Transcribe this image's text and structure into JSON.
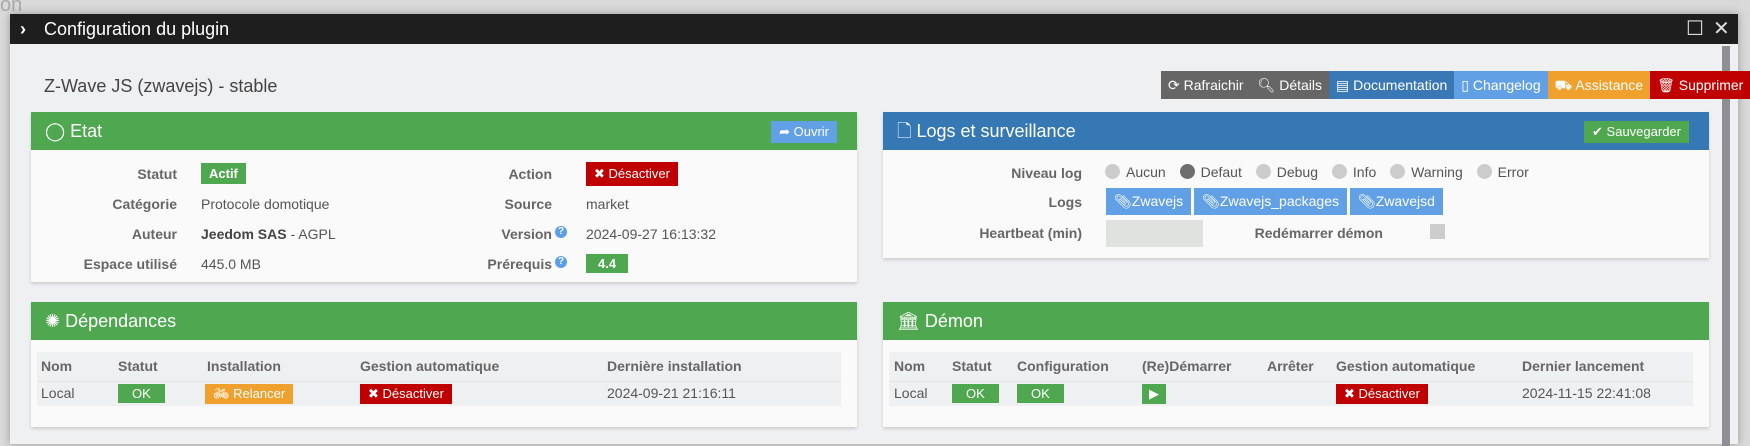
{
  "background": {
    "snippet": "on"
  },
  "modal": {
    "title": "Configuration du plugin"
  },
  "plugin": {
    "title": "Z-Wave JS (zwavejs) - stable"
  },
  "toolbar": {
    "refresh": "Rafraichir",
    "details": "Détails",
    "documentation": "Documentation",
    "changelog": "Changelog",
    "assistance": "Assistance",
    "delete": "Supprimer"
  },
  "etat": {
    "title": "Etat",
    "open": "Ouvrir",
    "statut_label": "Statut",
    "statut": "Actif",
    "categorie_label": "Catégorie",
    "categorie": "Protocole domotique",
    "auteur_label": "Auteur",
    "auteur": "Jeedom SAS",
    "licence": "- AGPL",
    "espace_label": "Espace utilisé",
    "espace": "445.0 MB",
    "action_label": "Action",
    "action": "Désactiver",
    "source_label": "Source",
    "source": "market",
    "version_label": "Version",
    "version": "2024-09-27 16:13:32",
    "prerequis_label": "Prérequis",
    "prerequis": "4.4"
  },
  "logs": {
    "title": "Logs et surveillance",
    "save": "Sauvegarder",
    "level_label": "Niveau log",
    "levels": [
      "Aucun",
      "Defaut",
      "Debug",
      "Info",
      "Warning",
      "Error"
    ],
    "selected_level": "Defaut",
    "logs_label": "Logs",
    "files": [
      "Zwavejs",
      "Zwavejs_packages",
      "Zwavejsd"
    ],
    "heartbeat_label": "Heartbeat (min)",
    "heartbeat_value": "",
    "restart_label": "Redémarrer démon",
    "restart_checked": false
  },
  "deps": {
    "title": "Dépendances",
    "headers": [
      "Nom",
      "Statut",
      "Installation",
      "Gestion automatique",
      "Dernière installation"
    ],
    "row": {
      "nom": "Local",
      "statut": "OK",
      "installation": "Relancer",
      "gestion": "Désactiver",
      "derniere": "2024-09-21 21:16:11"
    }
  },
  "demon": {
    "title": "Démon",
    "headers": [
      "Nom",
      "Statut",
      "Configuration",
      "(Re)Démarrer",
      "Arrêter",
      "Gestion automatique",
      "Dernier lancement"
    ],
    "row": {
      "nom": "Local",
      "statut": "OK",
      "configuration": "OK",
      "gestion": "Désactiver",
      "dernier": "2024-11-15 22:41:08"
    }
  },
  "colors": {
    "green": "#4fa84f",
    "blue": "#3578b4",
    "red": "#c00000",
    "orange": "#f0a02c",
    "lightblue": "#62a0e6",
    "gray": "#666666"
  }
}
